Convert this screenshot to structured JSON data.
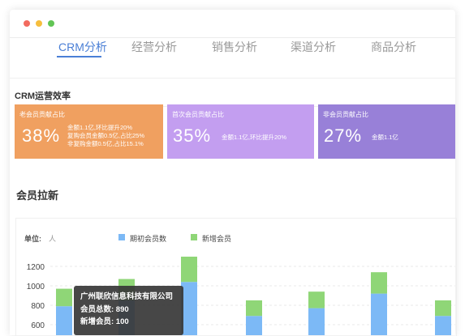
{
  "tabs": [
    "CRM分析",
    "经营分析",
    "销售分析",
    "渠道分析",
    "商品分析"
  ],
  "active_tab": 0,
  "section1": {
    "title": "CRM运营效率"
  },
  "cards": [
    {
      "title": "老会员贡献占比",
      "pct": "38%",
      "lines": [
        "金额1.1亿,环比提升20%",
        "复购会员金额0.5亿,占比25%",
        "非复购金额0.5亿,占比15.1%"
      ],
      "color": "#f0a060"
    },
    {
      "title": "首次会员贡献占比",
      "pct": "35%",
      "lines": [
        "金额1.1亿,环比提升20%"
      ],
      "color": "#c39ef0"
    },
    {
      "title": "非会员贡献占比",
      "pct": "27%",
      "lines": [
        "金额1.1亿"
      ],
      "color": "#9880d8"
    }
  ],
  "section2": {
    "title": "会员拉新"
  },
  "chart_data": {
    "type": "bar",
    "unit_label": "单位:",
    "unit_value": "人",
    "legend": [
      {
        "name": "期初会员数",
        "color": "#7cb9f6"
      },
      {
        "name": "新增会员",
        "color": "#8fd677"
      }
    ],
    "y_ticks": [
      1200,
      1000,
      800,
      600
    ],
    "series": [
      {
        "name": "期初会员数",
        "values": [
          790,
          850,
          1040,
          690,
          770,
          920,
          690
        ]
      },
      {
        "name": "新增会员",
        "values": [
          180,
          220,
          260,
          160,
          170,
          220,
          160
        ]
      }
    ]
  },
  "tooltip": {
    "title": "广州联欣信息科技有限公司",
    "row1": "会员总数:   890",
    "row2": "新增会员:   100"
  }
}
